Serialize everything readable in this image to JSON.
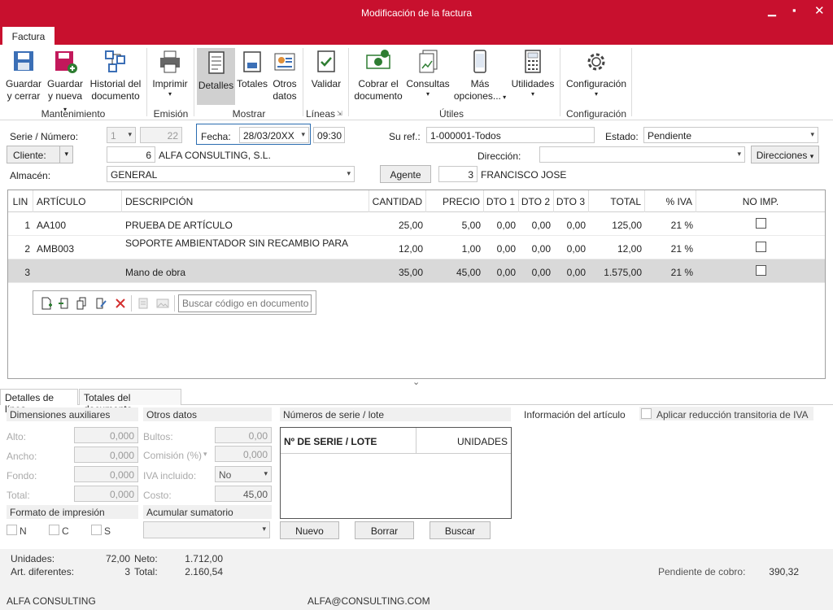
{
  "window": {
    "title": "Modificación de la factura"
  },
  "ribbon": {
    "tab": "Factura",
    "buttons": {
      "guardar_cerrar": [
        "Guardar",
        "y cerrar"
      ],
      "guardar_nueva": [
        "Guardar",
        "y nueva"
      ],
      "historial": [
        "Historial del",
        "documento"
      ],
      "imprimir": "Imprimir",
      "detalles": "Detalles",
      "totales": "Totales",
      "otros_datos": [
        "Otros",
        "datos"
      ],
      "validar": "Validar",
      "cobrar": [
        "Cobrar el",
        "documento"
      ],
      "consultas": "Consultas",
      "mas_opciones": [
        "Más",
        "opciones..."
      ],
      "utilidades": "Utilidades",
      "configuracion": "Configuración"
    },
    "groups": {
      "mantenimiento": "Mantenimiento",
      "emision": "Emisión",
      "mostrar": "Mostrar",
      "lineas": "Líneas",
      "utiles": "Útiles",
      "configuracion": "Configuración"
    }
  },
  "form": {
    "serie_label": "Serie / Número:",
    "serie_value": "1",
    "numero_value": "22",
    "fecha_label": "Fecha:",
    "fecha_value": "28/03/20XX",
    "hora_value": "09:30",
    "suref_label": "Su ref.:",
    "suref_value": "1-000001-Todos",
    "estado_label": "Estado:",
    "estado_value": "Pendiente",
    "cliente_label": "Cliente:",
    "cliente_code": "6",
    "cliente_name": "ALFA CONSULTING, S.L.",
    "direccion_label": "Dirección:",
    "direcciones_label": "Direcciones",
    "almacen_label": "Almacén:",
    "almacen_value": "GENERAL",
    "agente_label": "Agente",
    "agente_code": "3",
    "agente_name": "FRANCISCO JOSE"
  },
  "grid": {
    "headers": [
      "LIN",
      "ARTÍCULO",
      "DESCRIPCIÓN",
      "CANTIDAD",
      "PRECIO",
      "DTO 1",
      "DTO 2",
      "DTO 3",
      "TOTAL",
      "% IVA",
      "NO IMP."
    ],
    "rows": [
      {
        "lin": "1",
        "articulo": "AA100",
        "descripcion": "PRUEBA DE ARTÍCULO",
        "cantidad": "25,00",
        "precio": "5,00",
        "dto1": "0,00",
        "dto2": "0,00",
        "dto3": "0,00",
        "total": "125,00",
        "iva": "21 %"
      },
      {
        "lin": "2",
        "articulo": "AMB003",
        "descripcion": "SOPORTE AMBIENTADOR SIN RECAMBIO PARA",
        "cantidad": "12,00",
        "precio": "1,00",
        "dto1": "0,00",
        "dto2": "0,00",
        "dto3": "0,00",
        "total": "12,00",
        "iva": "21 %"
      },
      {
        "lin": "3",
        "articulo": "",
        "descripcion": "Mano de obra",
        "cantidad": "35,00",
        "precio": "45,00",
        "dto1": "0,00",
        "dto2": "0,00",
        "dto3": "0,00",
        "total": "1.575,00",
        "iva": "21 %"
      }
    ],
    "search_placeholder": "Buscar código en documento"
  },
  "bottom": {
    "tabs": [
      "Detalles de línea",
      "Totales del documento"
    ],
    "dim_title": "Dimensiones auxiliares",
    "alto": "Alto:",
    "ancho": "Ancho:",
    "fondo": "Fondo:",
    "total": "Total:",
    "alto_v": "0,000",
    "ancho_v": "0,000",
    "fondo_v": "0,000",
    "total_v": "0,000",
    "otros_title": "Otros datos",
    "bultos": "Bultos:",
    "bultos_v": "0,00",
    "comision": "Comisión (%)",
    "comision_v": "0,000",
    "iva_incl": "IVA incluido:",
    "iva_incl_v": "No",
    "costo": "Costo:",
    "costo_v": "45,00",
    "formato_title": "Formato de impresión",
    "fmt_n": "N",
    "fmt_c": "C",
    "fmt_s": "S",
    "acumular_title": "Acumular sumatorio",
    "serie_title": "Números de serie / lote",
    "serie_col1": "Nº DE SERIE / LOTE",
    "serie_col2": "UNIDADES",
    "btn_nuevo": "Nuevo",
    "btn_borrar": "Borrar",
    "btn_buscar": "Buscar",
    "info_title": "Información del artículo",
    "reduccion": "Aplicar reducción transitoria de IVA"
  },
  "footer": {
    "unidades_label": "Unidades:",
    "unidades": "72,00",
    "art_label": "Art. diferentes:",
    "art": "3",
    "neto_label": "Neto:",
    "neto": "1.712,00",
    "total_label": "Total:",
    "total": "2.160,54",
    "pendiente_label": "Pendiente de cobro:",
    "pendiente": "390,32",
    "company": "ALFA CONSULTING",
    "email": "ALFA@CONSULTING.COM"
  }
}
